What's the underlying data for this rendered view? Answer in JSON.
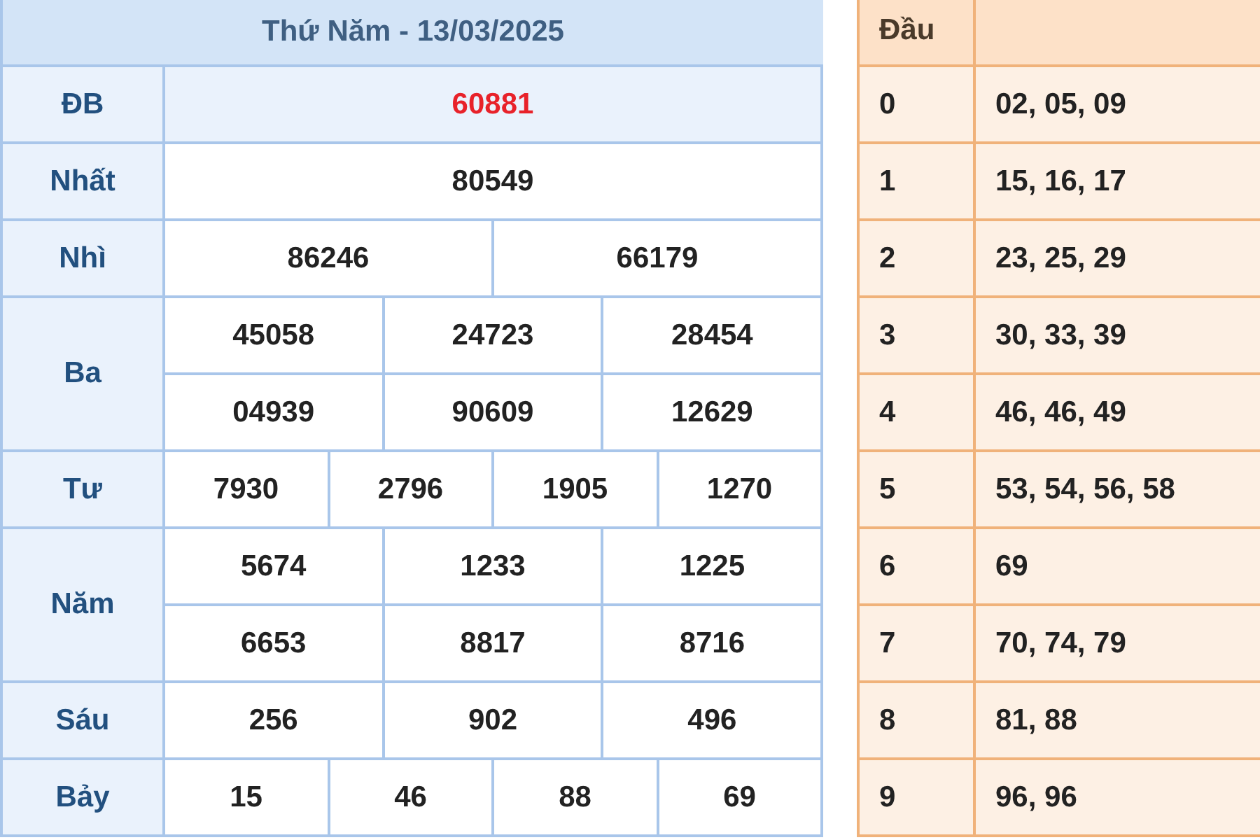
{
  "results": {
    "title": "Thứ Năm - 13/03/2025",
    "prizes": [
      {
        "label": "ĐB",
        "highlight": true,
        "lines": [
          [
            "60881"
          ]
        ]
      },
      {
        "label": "Nhất",
        "highlight": false,
        "lines": [
          [
            "80549"
          ]
        ]
      },
      {
        "label": "Nhì",
        "highlight": false,
        "lines": [
          [
            "86246",
            "66179"
          ]
        ]
      },
      {
        "label": "Ba",
        "highlight": false,
        "lines": [
          [
            "45058",
            "24723",
            "28454"
          ],
          [
            "04939",
            "90609",
            "12629"
          ]
        ]
      },
      {
        "label": "Tư",
        "highlight": false,
        "lines": [
          [
            "7930",
            "2796",
            "1905",
            "1270"
          ]
        ]
      },
      {
        "label": "Năm",
        "highlight": false,
        "lines": [
          [
            "5674",
            "1233",
            "1225"
          ],
          [
            "6653",
            "8817",
            "8716"
          ]
        ]
      },
      {
        "label": "Sáu",
        "highlight": false,
        "lines": [
          [
            "256",
            "902",
            "496"
          ]
        ]
      },
      {
        "label": "Bảy",
        "highlight": false,
        "lines": [
          [
            "15",
            "46",
            "88",
            "69"
          ]
        ]
      }
    ]
  },
  "heads": {
    "column_1": "Đầu",
    "rows": [
      {
        "head": "0",
        "tails": "02, 05, 09"
      },
      {
        "head": "1",
        "tails": "15, 16, 17"
      },
      {
        "head": "2",
        "tails": "23, 25, 29"
      },
      {
        "head": "3",
        "tails": "30, 33, 39"
      },
      {
        "head": "4",
        "tails": "46, 46, 49"
      },
      {
        "head": "5",
        "tails": "53, 54, 56, 58"
      },
      {
        "head": "6",
        "tails": "69"
      },
      {
        "head": "7",
        "tails": "70, 74, 79"
      },
      {
        "head": "8",
        "tails": "81, 88"
      },
      {
        "head": "9",
        "tails": "96, 96"
      }
    ]
  }
}
